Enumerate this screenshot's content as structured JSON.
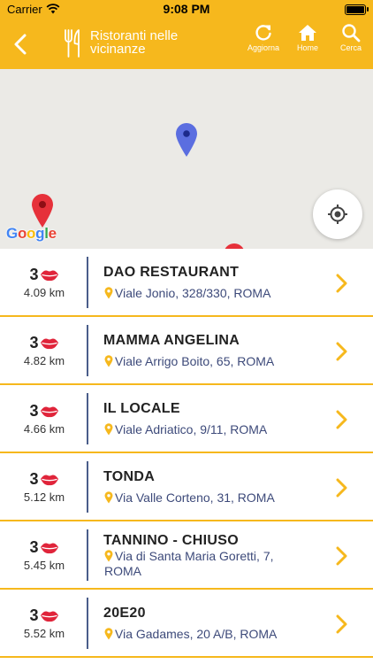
{
  "status_bar": {
    "carrier": "Carrier",
    "time": "9:08 PM"
  },
  "nav": {
    "title": "Ristoranti nelle vicinanze",
    "refresh_label": "Aggiorna",
    "home_label": "Home",
    "search_label": "Cerca"
  },
  "map": {
    "logo": "Google"
  },
  "restaurants": [
    {
      "rating": "3",
      "distance": "4.09 km",
      "name": "DAO RESTAURANT",
      "address": "Viale Jonio, 328/330, ROMA"
    },
    {
      "rating": "3",
      "distance": "4.82 km",
      "name": "MAMMA ANGELINA",
      "address": "Viale Arrigo Boito, 65, ROMA"
    },
    {
      "rating": "3",
      "distance": "4.66 km",
      "name": "IL LOCALE",
      "address": "Viale Adriatico, 9/11, ROMA"
    },
    {
      "rating": "3",
      "distance": "5.12 km",
      "name": "TONDA",
      "address": "Via Valle Corteno, 31, ROMA"
    },
    {
      "rating": "3",
      "distance": "5.45 km",
      "name": "TANNINO - CHIUSO",
      "address": "Via di Santa Maria Goretti, 7, ROMA"
    },
    {
      "rating": "3",
      "distance": "5.52 km",
      "name": "20E20",
      "address": "Via Gadames, 20 A/B, ROMA"
    }
  ],
  "colors": {
    "accent": "#F6B81D",
    "divider": "#4A5D8A",
    "address": "#3D4A7A",
    "lips": "#E0243A"
  }
}
